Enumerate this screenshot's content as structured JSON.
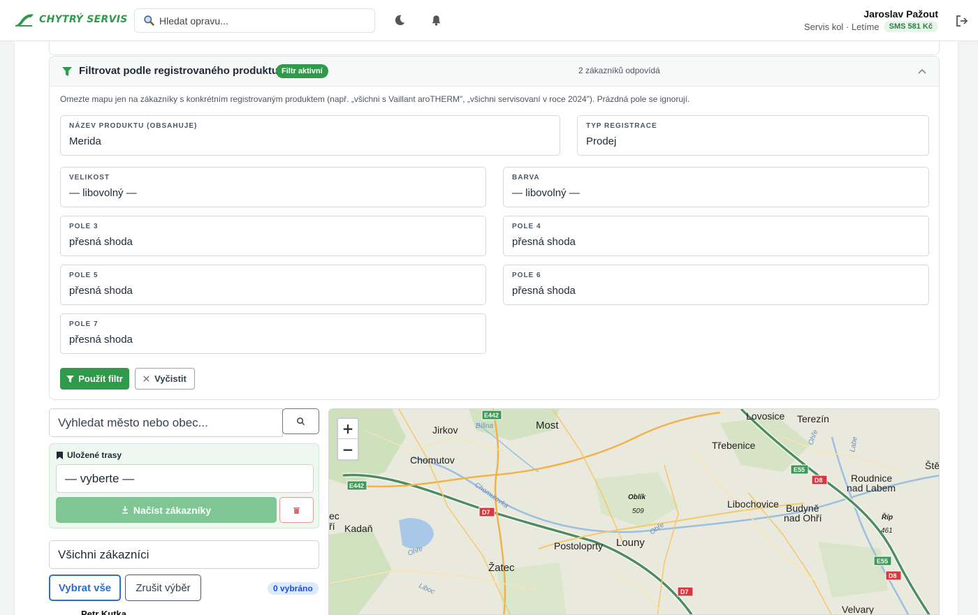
{
  "brand": {
    "name": "CHYTRÝ SERVIS"
  },
  "header": {
    "search_placeholder": "Hledat opravu...",
    "user_name": "Jaroslav Pažout",
    "user_org": "Servis kol · Letíme",
    "sms_badge": "SMS 581 Kč"
  },
  "filter": {
    "title": "Filtrovat podle registrovaného produktu",
    "active_badge": "Filtr aktivní",
    "match_count": "2 zákazníků odpovídá",
    "help": "Omezte mapu jen na zákazníky s konkrétním registrovaným produktem (např. „všichni s Vaillant aroTHERM\", „všichni servisovaní v roce 2024\"). Prázdná pole se ignorují.",
    "fields": {
      "product_name": {
        "label": "NÁZEV PRODUKTU (OBSAHUJE)",
        "value": "Merida"
      },
      "reg_type": {
        "label": "TYP REGISTRACE",
        "value": "Prodej"
      },
      "size": {
        "label": "VELIKOST",
        "value": "— libovolný —"
      },
      "color": {
        "label": "BARVA",
        "value": "— libovolný —"
      },
      "field3": {
        "label": "POLE 3",
        "value": "přesná shoda"
      },
      "field4": {
        "label": "POLE 4",
        "value": "přesná shoda"
      },
      "field5": {
        "label": "POLE 5",
        "value": "přesná shoda"
      },
      "field6": {
        "label": "POLE 6",
        "value": "přesná shoda"
      },
      "field7": {
        "label": "POLE 7",
        "value": "přesná shoda"
      }
    },
    "apply_label": "Použít filtr",
    "clear_label": "Vyčistit"
  },
  "sidebar": {
    "city_search_placeholder": "Vyhledat město nebo obec...",
    "saved_routes_title": "Uložené trasy",
    "saved_routes_value": "— vyberte —",
    "load_customers_label": "Načíst zákazníky",
    "customer_select_value": "Všichni zákazníci",
    "select_all_label": "Vybrat vše",
    "clear_selection_label": "Zrušit výběr",
    "selected_count": "0 vybráno",
    "list_peek": "Petr Kutka"
  },
  "map": {
    "zoom_in": "+",
    "zoom_out": "−",
    "places": {
      "most": "Most",
      "jirkov": "Jirkov",
      "bilina": "Bílina",
      "chomutov": "Chomutov",
      "kadan": "Kadaň",
      "lovosice": "Lovosice",
      "terezin": "Terezín",
      "trebenice": "Třebenice",
      "roudnice1": "Roudnice",
      "roudnice2": "nad Labem",
      "libochovice": "Libochovice",
      "budyne1": "Budyně",
      "budyne2": "nad Ohří",
      "postoloprty": "Postoloprty",
      "louny": "Louny",
      "zatec": "Žatec",
      "velvary": "Velvary",
      "oblik": "Oblík",
      "oblik_h": "509",
      "rip": "Říp",
      "rip_h": "461",
      "chomutovka": "Chomutovka",
      "ohre1": "Ohře",
      "ohre2": "Ohře",
      "ohre3": "Ohře",
      "labe": "Labe",
      "liboc": "Liboc",
      "ste": "Ště",
      "ec": "ec",
      "ri": "ří",
      "e442a": "E442",
      "e442b": "E442",
      "e55a": "E55",
      "e55b": "E55",
      "d8a": "D8",
      "d8b": "D8",
      "d7a": "D7",
      "d7b": "D7"
    }
  }
}
